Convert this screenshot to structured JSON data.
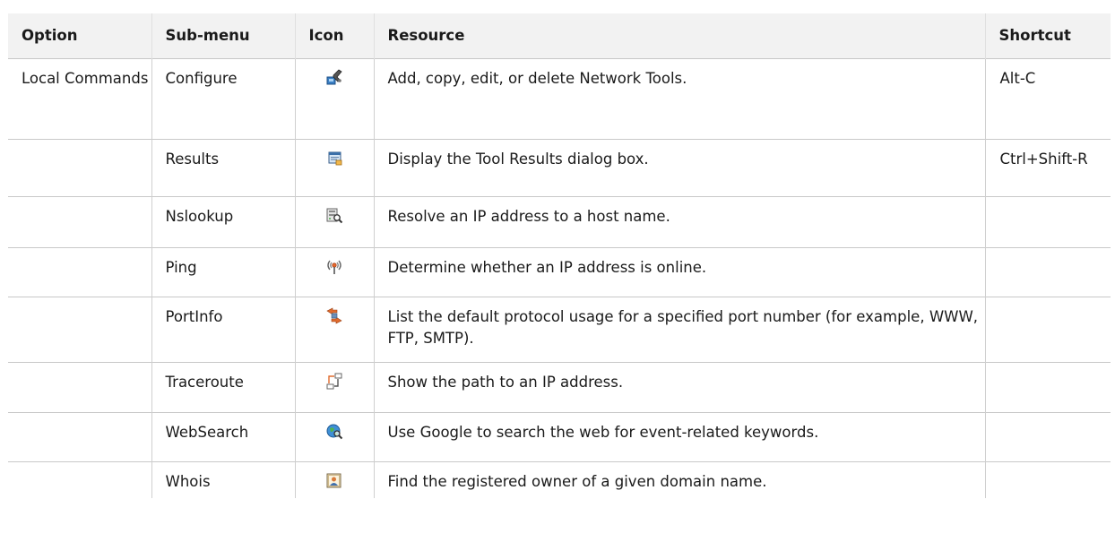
{
  "table": {
    "headers": {
      "option": "Option",
      "submenu": "Sub-menu",
      "icon": "Icon",
      "resource": "Resource",
      "shortcut": "Shortcut"
    },
    "rows": [
      {
        "option": "Local Commands",
        "submenu": "Configure",
        "icon": "wrench-tool-icon",
        "resource": "Add, copy, edit, or delete Network Tools.",
        "shortcut": "Alt-C"
      },
      {
        "option": "",
        "submenu": "Results",
        "icon": "results-window-icon",
        "resource": "Display the Tool Results dialog box.",
        "shortcut": "Ctrl+Shift-R"
      },
      {
        "option": "",
        "submenu": "Nslookup",
        "icon": "server-search-icon",
        "resource": "Resolve an IP address to a host name.",
        "shortcut": ""
      },
      {
        "option": "",
        "submenu": "Ping",
        "icon": "signal-broadcast-icon",
        "resource": "Determine whether an IP address is online.",
        "shortcut": ""
      },
      {
        "option": "",
        "submenu": "PortInfo",
        "icon": "port-arrows-icon",
        "resource": "List the default protocol usage for a specified port number (for example, WWW, FTP, SMTP).",
        "shortcut": ""
      },
      {
        "option": "",
        "submenu": "Traceroute",
        "icon": "route-path-icon",
        "resource": "Show the path to an IP address.",
        "shortcut": ""
      },
      {
        "option": "",
        "submenu": "WebSearch",
        "icon": "globe-search-icon",
        "resource": "Use Google to search the web for event-related keywords.",
        "shortcut": ""
      },
      {
        "option": "",
        "submenu": "Whois",
        "icon": "user-lookup-icon",
        "resource": "Find the registered owner of a given domain name.",
        "shortcut": ""
      }
    ]
  }
}
